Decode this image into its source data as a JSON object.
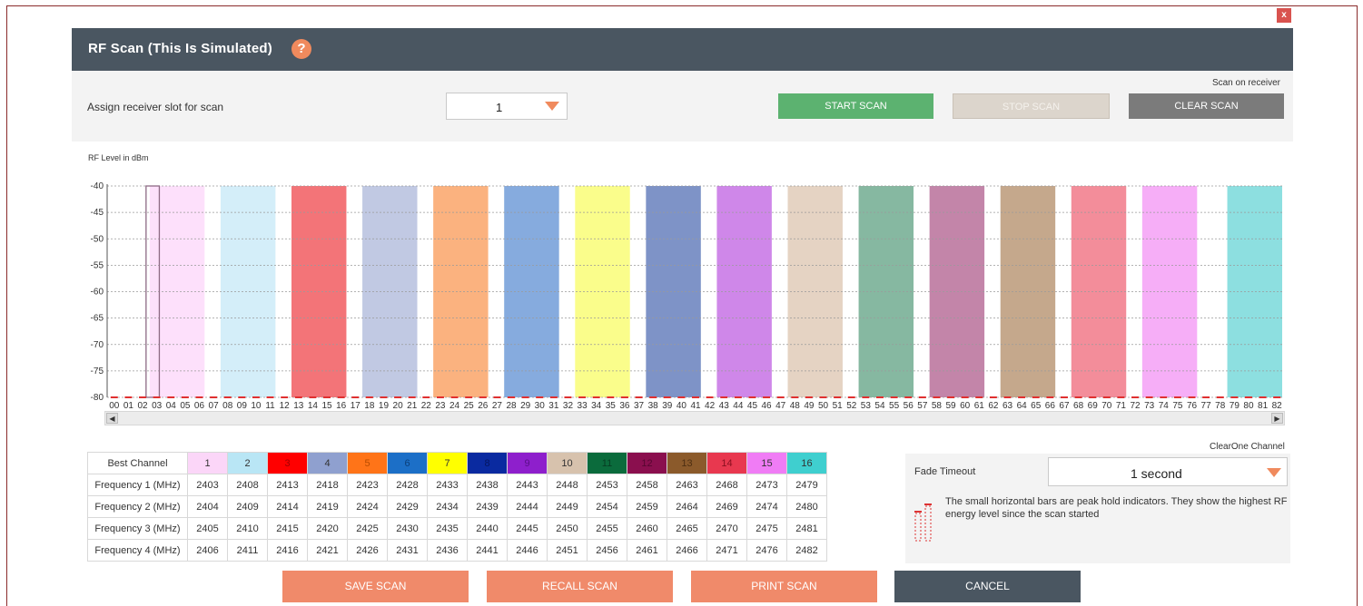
{
  "header": {
    "title": "RF Scan  (This Is Simulated)",
    "help": "?"
  },
  "close": "x",
  "controls": {
    "assign_label": "Assign receiver slot for scan",
    "slot_value": "1",
    "scan_on_label": "Scan on receiver",
    "start": "START SCAN",
    "stop": "STOP SCAN",
    "clear": "CLEAR SCAN"
  },
  "chart_data": {
    "type": "bar",
    "ylabel": "RF Level in dBm",
    "ylim": [
      -80,
      -40
    ],
    "yticks": [
      "-40",
      "-45",
      "-50",
      "-55",
      "-60",
      "-65",
      "-70",
      "-75",
      "-80"
    ],
    "x_channels": [
      "00",
      "01",
      "02",
      "03",
      "04",
      "05",
      "06",
      "07",
      "08",
      "09",
      "10",
      "11",
      "12",
      "13",
      "14",
      "15",
      "16",
      "17",
      "18",
      "19",
      "20",
      "21",
      "22",
      "23",
      "24",
      "25",
      "26",
      "27",
      "28",
      "29",
      "30",
      "31",
      "32",
      "33",
      "34",
      "35",
      "36",
      "37",
      "38",
      "39",
      "40",
      "41",
      "42",
      "43",
      "44",
      "45",
      "46",
      "47",
      "48",
      "49",
      "50",
      "51",
      "52",
      "53",
      "54",
      "55",
      "56",
      "57",
      "58",
      "59",
      "60",
      "61",
      "62",
      "63",
      "64",
      "65",
      "66",
      "67",
      "68",
      "69",
      "70",
      "71",
      "72",
      "73",
      "74",
      "75",
      "76",
      "77",
      "78",
      "79",
      "80",
      "81",
      "82"
    ],
    "bands": [
      {
        "channel": "1",
        "from": 3,
        "to": 7,
        "color": "#fde0fb"
      },
      {
        "channel": "2",
        "from": 8,
        "to": 12,
        "color": "#d4eef9"
      },
      {
        "channel": "3",
        "from": 13,
        "to": 17,
        "color": "#f37478"
      },
      {
        "channel": "4",
        "from": 18,
        "to": 22,
        "color": "#c1c9e3"
      },
      {
        "channel": "5",
        "from": 23,
        "to": 27,
        "color": "#fbb27f"
      },
      {
        "channel": "6",
        "from": 28,
        "to": 32,
        "color": "#86abde"
      },
      {
        "channel": "7",
        "from": 33,
        "to": 37,
        "color": "#fafd8b"
      },
      {
        "channel": "8",
        "from": 38,
        "to": 42,
        "color": "#7e93c7"
      },
      {
        "channel": "9",
        "from": 43,
        "to": 47,
        "color": "#cf87e9"
      },
      {
        "channel": "10",
        "from": 48,
        "to": 52,
        "color": "#e5d3c3"
      },
      {
        "channel": "11",
        "from": 53,
        "to": 57,
        "color": "#86b8a1"
      },
      {
        "channel": "12",
        "from": 58,
        "to": 62,
        "color": "#c385a9"
      },
      {
        "channel": "13",
        "from": 63,
        "to": 67,
        "color": "#c5a88c"
      },
      {
        "channel": "14",
        "from": 68,
        "to": 72,
        "color": "#f38d9a"
      },
      {
        "channel": "15",
        "from": 73,
        "to": 77,
        "color": "#f6aef7"
      },
      {
        "channel": "16",
        "from": 79,
        "to": 83,
        "color": "#8ddfe0"
      }
    ],
    "band_level": -40,
    "selected_channel": "03"
  },
  "table": {
    "header_label": "Best Channel",
    "channels": [
      {
        "num": "1",
        "bg": "#fbd6f8",
        "fg": "#333"
      },
      {
        "num": "2",
        "bg": "#b9e6f5",
        "fg": "#333"
      },
      {
        "num": "3",
        "bg": "#ff0000",
        "fg": "#a00000"
      },
      {
        "num": "4",
        "bg": "#8fa0cf",
        "fg": "#333"
      },
      {
        "num": "5",
        "bg": "#ff7418",
        "fg": "#b84c00"
      },
      {
        "num": "6",
        "bg": "#1c6fc7",
        "fg": "#0c3f7a"
      },
      {
        "num": "7",
        "bg": "#ffff00",
        "fg": "#333"
      },
      {
        "num": "8",
        "bg": "#0a2aa0",
        "fg": "#051660"
      },
      {
        "num": "9",
        "bg": "#8e1fcc",
        "fg": "#5a0f88"
      },
      {
        "num": "10",
        "bg": "#d7c2ad",
        "fg": "#333"
      },
      {
        "num": "11",
        "bg": "#0b6b3c",
        "fg": "#063d22"
      },
      {
        "num": "12",
        "bg": "#8a0f4e",
        "fg": "#560630"
      },
      {
        "num": "13",
        "bg": "#8b5a2b",
        "fg": "#4e2f12"
      },
      {
        "num": "14",
        "bg": "#e8384f",
        "fg": "#8a1020"
      },
      {
        "num": "15",
        "bg": "#f07cf5",
        "fg": "#333"
      },
      {
        "num": "16",
        "bg": "#3fcfcf",
        "fg": "#333"
      }
    ],
    "rows": [
      {
        "label": "Frequency 1 (MHz)",
        "values": [
          "2403",
          "2408",
          "2413",
          "2418",
          "2423",
          "2428",
          "2433",
          "2438",
          "2443",
          "2448",
          "2453",
          "2458",
          "2463",
          "2468",
          "2473",
          "2479"
        ]
      },
      {
        "label": "Frequency 2 (MHz)",
        "values": [
          "2404",
          "2409",
          "2414",
          "2419",
          "2424",
          "2429",
          "2434",
          "2439",
          "2444",
          "2449",
          "2454",
          "2459",
          "2464",
          "2469",
          "2474",
          "2480"
        ]
      },
      {
        "label": "Frequency 3 (MHz)",
        "values": [
          "2405",
          "2410",
          "2415",
          "2420",
          "2425",
          "2430",
          "2435",
          "2440",
          "2445",
          "2450",
          "2455",
          "2460",
          "2465",
          "2470",
          "2475",
          "2481"
        ]
      },
      {
        "label": "Frequency 4 (MHz)",
        "values": [
          "2406",
          "2411",
          "2416",
          "2421",
          "2426",
          "2431",
          "2436",
          "2441",
          "2446",
          "2451",
          "2456",
          "2461",
          "2466",
          "2471",
          "2476",
          "2482"
        ]
      }
    ]
  },
  "right_panel": {
    "clearone_label": "ClearOne Channel",
    "fade_label": "Fade Timeout",
    "fade_value": "1 second",
    "peak_text": "The small horizontal bars are peak hold indicators. They show the highest RF energy level since the scan started"
  },
  "scroll": {
    "left": "◀",
    "right": "▶"
  },
  "buttons": {
    "save": "SAVE SCAN",
    "recall": "RECALL SCAN",
    "print": "PRINT SCAN",
    "cancel": "CANCEL"
  },
  "colors": {
    "header_bg": "#4a5661",
    "accent": "#f08a5d",
    "start": "#5cb270",
    "peak": "#e03030"
  }
}
